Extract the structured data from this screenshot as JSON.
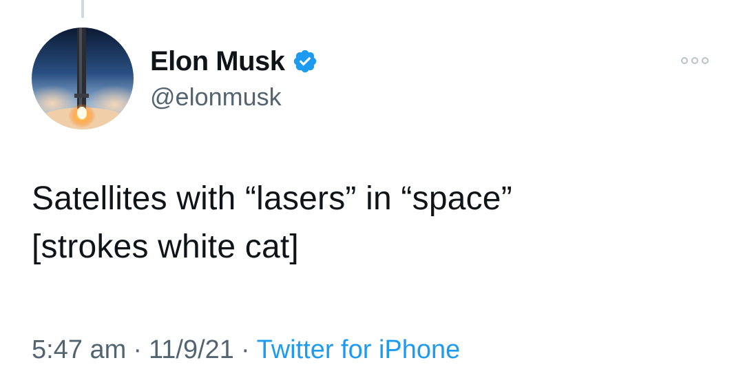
{
  "colors": {
    "text_primary": "#0f1419",
    "text_secondary": "#536471",
    "accent": "#1d9bf0",
    "divider": "#cfd9de"
  },
  "tweet": {
    "author": {
      "display_name": "Elon Musk",
      "handle": "@elonmusk",
      "verified": true,
      "avatar_icon": "rocket-launch-avatar",
      "verified_icon": "verified-badge-icon"
    },
    "more_icon": "more-options-icon",
    "text_lines": [
      "Satellites with “lasers” in “space”",
      "[strokes white cat]"
    ],
    "meta": {
      "time": "5:47 am",
      "separator": "·",
      "date": "11/9/21",
      "source": "Twitter for iPhone"
    }
  }
}
